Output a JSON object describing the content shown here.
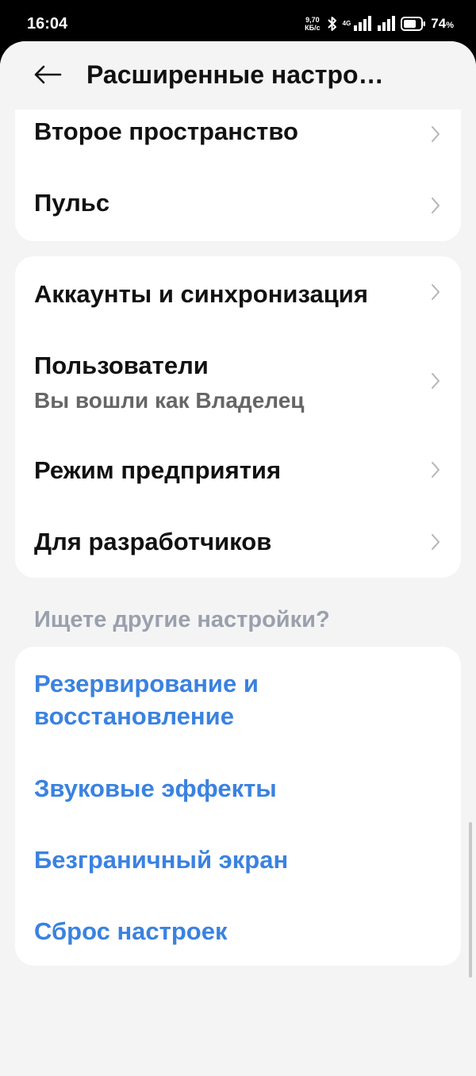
{
  "status": {
    "time": "16:04",
    "net_speed_value": "9,70",
    "net_speed_unit": "КБ/с",
    "net_type": "4G",
    "battery": "74",
    "battery_unit": "%"
  },
  "header": {
    "title": "Расширенные настро…"
  },
  "group1": {
    "items": [
      {
        "label": "Второе пространство"
      },
      {
        "label": "Пульс"
      }
    ]
  },
  "group2": {
    "items": [
      {
        "label": "Аккаунты и синхронизация"
      },
      {
        "label": "Пользователи",
        "sub": "Вы вошли как Владелец"
      },
      {
        "label": "Режим предприятия"
      },
      {
        "label": "Для разработчиков"
      }
    ]
  },
  "suggestions": {
    "heading": "Ищете другие настройки?",
    "links": [
      {
        "line1": "Резервирование и",
        "line2": "восстановление"
      },
      {
        "label": "Звуковые эффекты"
      },
      {
        "label": "Безграничный экран"
      },
      {
        "label": "Сброс настроек"
      }
    ]
  },
  "colors": {
    "link": "#3a82e0",
    "background": "#f4f4f4",
    "card": "#ffffff"
  }
}
